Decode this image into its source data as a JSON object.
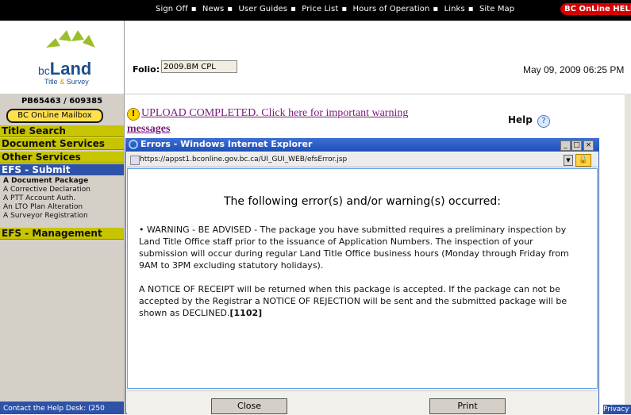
{
  "topnav": {
    "items": [
      "Sign Off",
      "News",
      "User Guides",
      "Price List",
      "Hours of Operation",
      "Links",
      "Site Map"
    ],
    "help_button": "BC OnLine HELP"
  },
  "logo": {
    "bc": "bc",
    "land": "Land",
    "title": "Title",
    "amp": "&",
    "survey": "Survey"
  },
  "sidebar": {
    "account": "PB65463 / 609385",
    "mailbox": "BC OnLine Mailbox",
    "sections": [
      "Title Search",
      "Document Services",
      "Other Services"
    ],
    "efs_submit": "EFS - Submit",
    "efs_submit_items": [
      "A Document Package",
      "A Corrective Declaration",
      "A PTT Account Auth.",
      "An LTO Plan Alteration",
      "A Surveyor Registration"
    ],
    "efs_management": "EFS - Management",
    "contact": "Contact the Help Desk: (250"
  },
  "main": {
    "folio_label": "Folio:",
    "folio_value": "2009.BM CPL",
    "datetime": "May 09, 2009 06:25 PM",
    "upload_link_line1": "UPLOAD COMPLETED. Click here for important warning",
    "upload_link_line2": "messages",
    "help": "Help",
    "privacy": "Privacy"
  },
  "popup": {
    "title": "Errors - Windows Internet Explorer",
    "url": "https://appst1.bconline.gov.bc.ca/UI_GUI_WEB/efsError.jsp",
    "heading": "The following error(s) and/or warning(s) occurred:",
    "warning": "• WARNING - BE ADVISED - The package you have submitted requires a preliminary inspection by Land Title Office staff prior to the issuance of Application Numbers. The inspection of your submission will occur during regular Land Title Office business hours (Monday through Friday from 9AM to 3PM excluding statutory holidays).",
    "notice": "A NOTICE OF RECEIPT will be returned when this package is accepted. If the package can not be accepted by the Registrar a NOTICE OF REJECTION will be sent and the submitted package will be shown as DECLINED.",
    "notice_code": "[1102]",
    "close_button": "Close",
    "print_button": "Print"
  }
}
